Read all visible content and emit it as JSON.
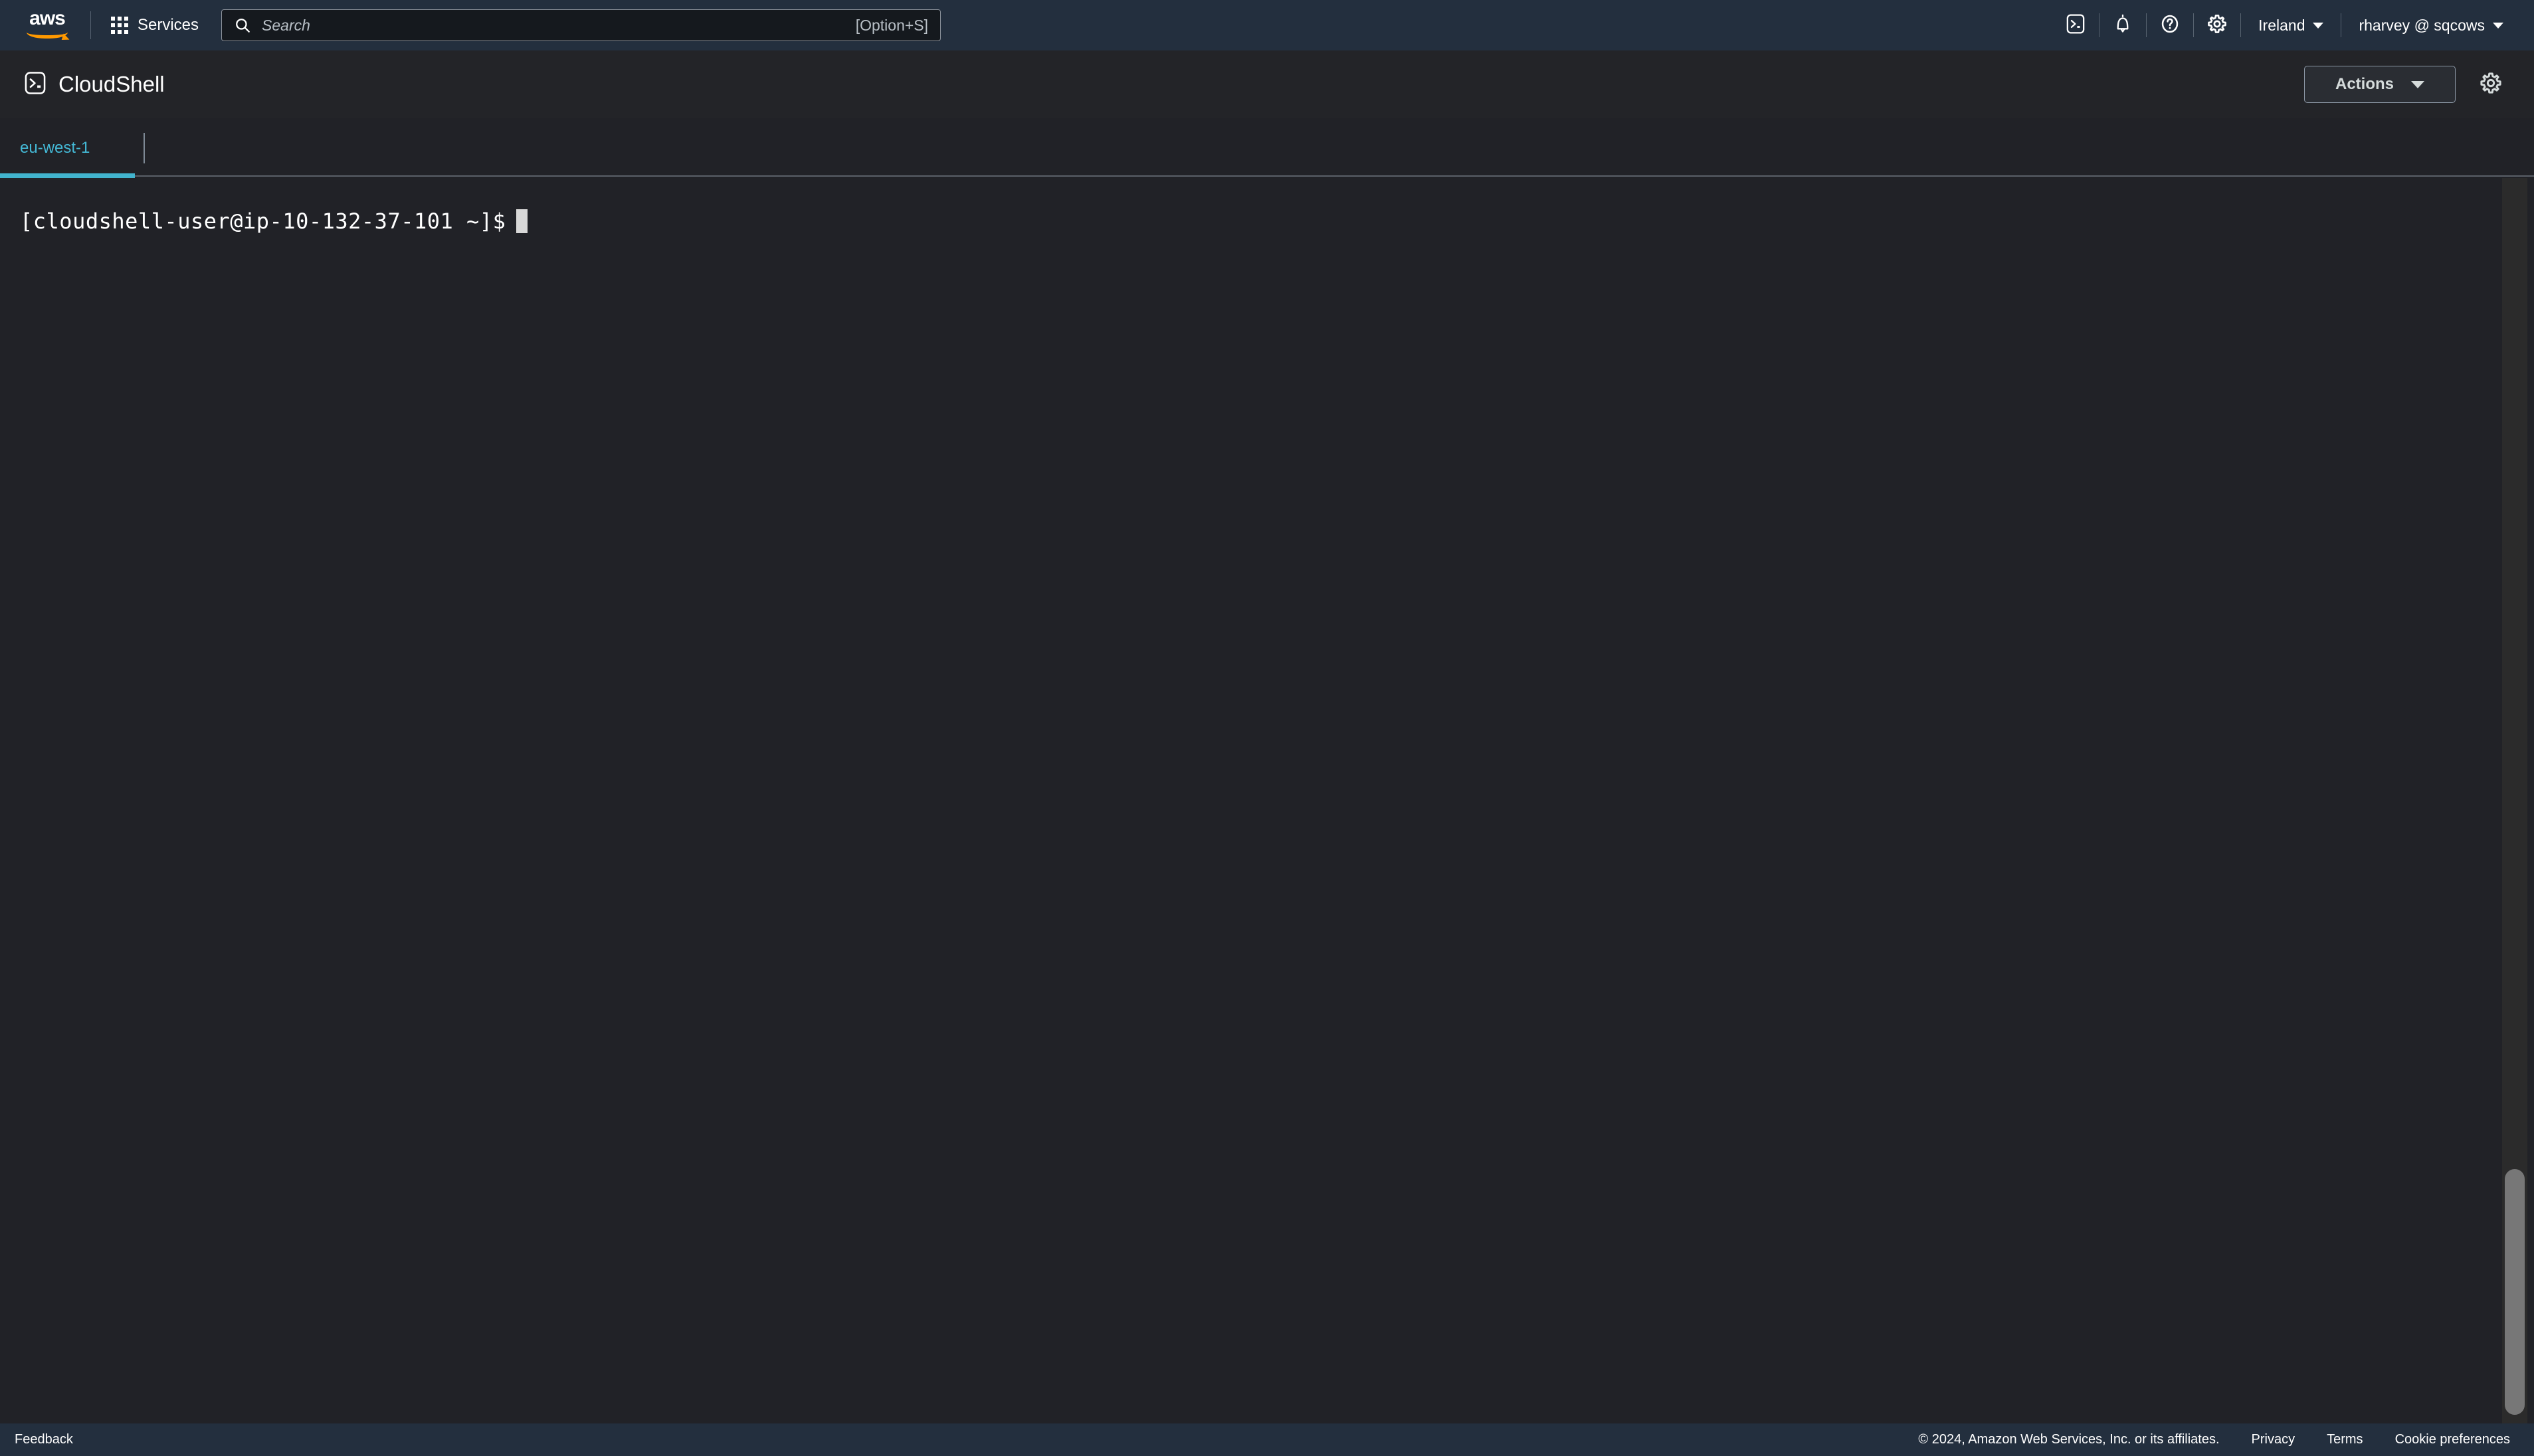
{
  "top_nav": {
    "logo_text": "aws",
    "services_label": "Services",
    "services_icon": "apps-grid-icon",
    "search": {
      "icon": "search-icon",
      "placeholder": "Search",
      "value": "",
      "shortcut": "[Option+S]"
    },
    "icons": [
      {
        "name": "cloudshell-icon",
        "title": "CloudShell"
      },
      {
        "name": "bell-icon",
        "title": "Notifications"
      },
      {
        "name": "help-icon",
        "title": "Help"
      },
      {
        "name": "gear-icon",
        "title": "Settings"
      }
    ],
    "region": "Ireland",
    "account": "rharvey @ sqcows"
  },
  "shell_header": {
    "icon": "cloudshell-icon",
    "title": "CloudShell",
    "actions_label": "Actions",
    "settings_icon": "gear-icon"
  },
  "tabs": [
    {
      "label": "eu-west-1",
      "active": true
    }
  ],
  "terminal": {
    "prompt": "[cloudshell-user@ip-10-132-37-101 ~]$",
    "input": "",
    "cursor": "block",
    "scrollbar": {
      "visible": true
    }
  },
  "footer": {
    "feedback": "Feedback",
    "copyright": "© 2024, Amazon Web Services, Inc. or its affiliates.",
    "privacy": "Privacy",
    "terms": "Terms",
    "cookie_preferences": "Cookie preferences"
  },
  "colors": {
    "nav_background": "#232f3e",
    "shell_background": "#212227",
    "accent_cyan": "#42b4ce",
    "tab_link": "#44b9d6",
    "logo_orange": "#ff9900",
    "terminal_text": "#ffffff"
  }
}
